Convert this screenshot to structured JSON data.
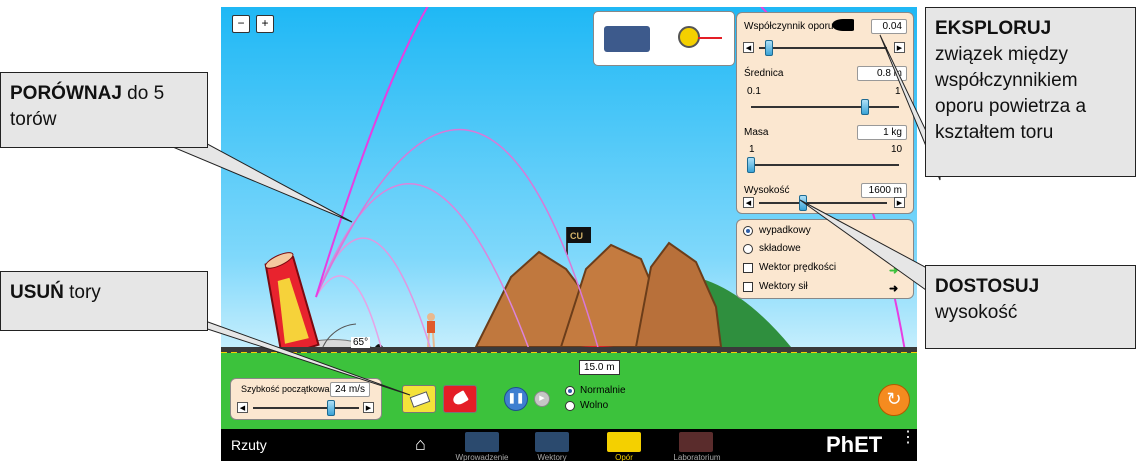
{
  "callouts": {
    "compare": {
      "bold": "PORÓWNAJ",
      "rest": " do 5 torów"
    },
    "erase": {
      "bold": "USUŃ",
      "rest": " tory"
    },
    "explore": {
      "bold": "EKSPLORUJ",
      "rest": "związek między współczynnikiem oporu powietrza a kształtem toru"
    },
    "adjust": {
      "bold": "DOSTOSUJ",
      "rest": "wysokość"
    }
  },
  "controls": {
    "drag": {
      "label": "Współczynnik oporu",
      "value": "0.04",
      "level": 0.04
    },
    "diameter": {
      "label": "Średnica",
      "value": "0.8 m",
      "min": "0.1",
      "max": "1",
      "level": 0.78
    },
    "mass": {
      "label": "Masa",
      "value": "1 kg",
      "min": "1",
      "max": "10",
      "level": 0.0
    },
    "altitude": {
      "label": "Wysokość",
      "value": "1600 m",
      "level": 0.38
    },
    "speed": {
      "label": "Szybkość początkowa",
      "value": "24 m/s",
      "level": 0.8
    }
  },
  "vectors": {
    "resultant": "wypadkowy",
    "components": "składowe",
    "velocity": "Wektor prędkości",
    "forces": "Wektory sił"
  },
  "playback": {
    "normal": "Normalnie",
    "slow": "Wolno"
  },
  "scene": {
    "angle": "65°",
    "target_distance": "15.0 m"
  },
  "navbar": {
    "title": "Rzuty",
    "tabs": [
      "Wprowadzenie",
      "Wektory",
      "Opór",
      "Laboratorium"
    ],
    "selected": 2,
    "brand": "PhET"
  },
  "colors": {
    "trajectory": "#e73ee2",
    "panel": "#fbe7d0",
    "sky": "#1fb8f5",
    "ground": "#3cc23c",
    "selected_tab": "#f4d000"
  }
}
